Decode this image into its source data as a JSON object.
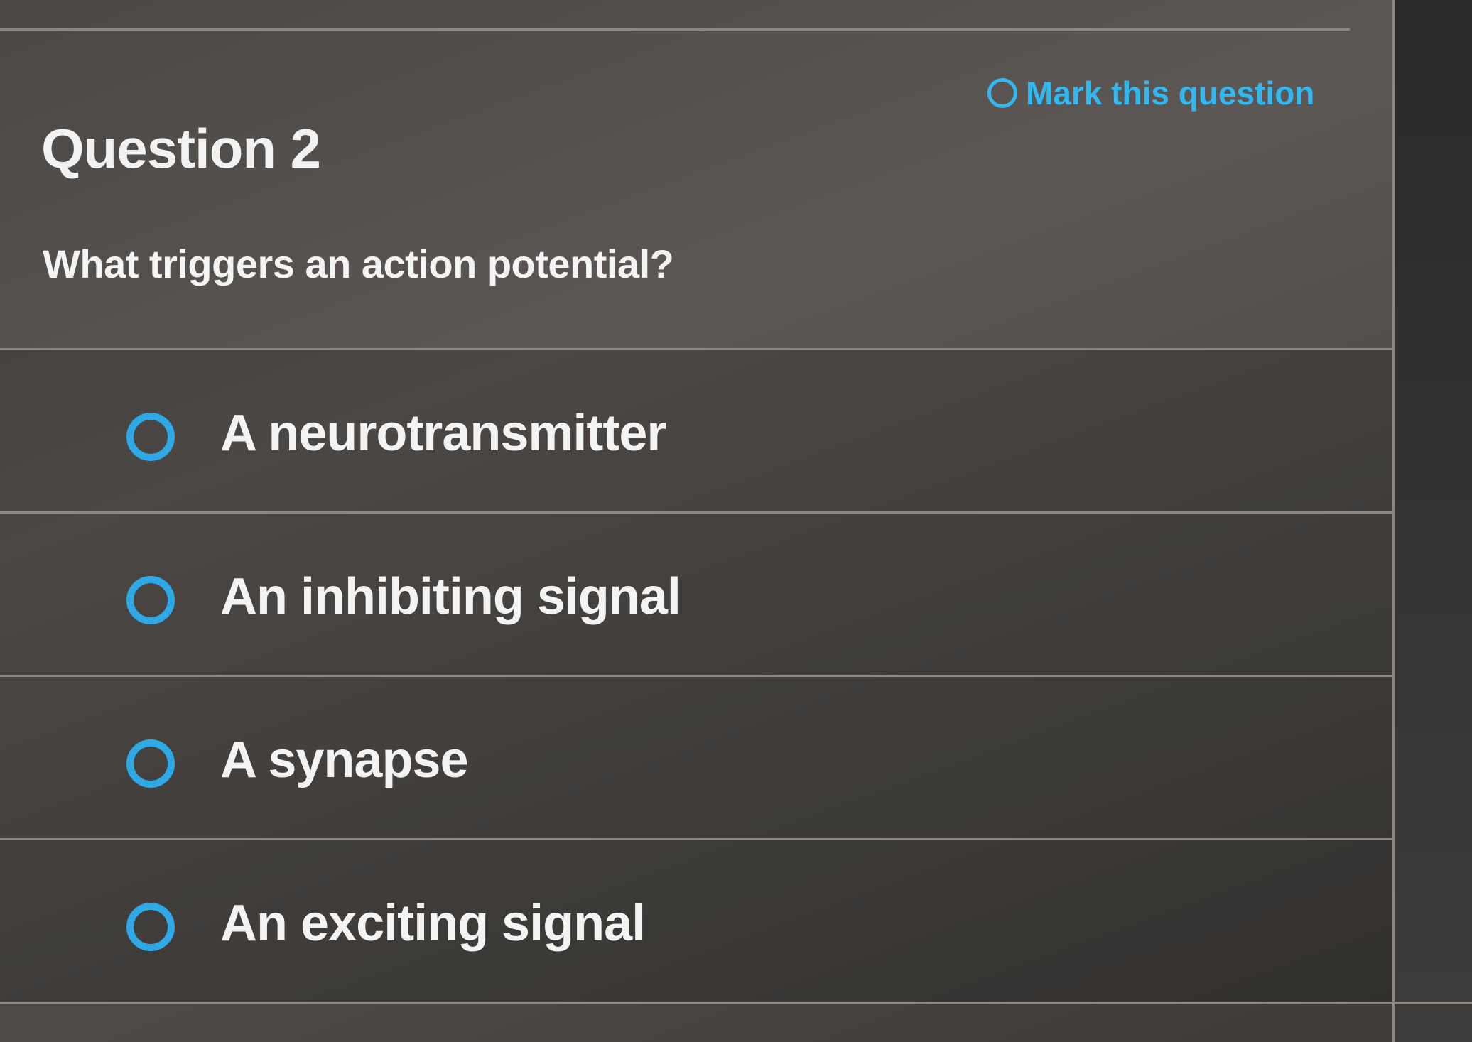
{
  "question": {
    "title": "Question 2",
    "text": "What triggers an action potential?",
    "mark_label": "Mark this question"
  },
  "options": [
    {
      "label": "A neurotransmitter",
      "selected": false
    },
    {
      "label": "An inhibiting signal",
      "selected": false
    },
    {
      "label": "A synapse",
      "selected": false
    },
    {
      "label": "An exciting signal",
      "selected": false
    }
  ],
  "colors": {
    "accent": "#33b7f0",
    "background": "#4a4744",
    "text": "#f3f3f3"
  }
}
